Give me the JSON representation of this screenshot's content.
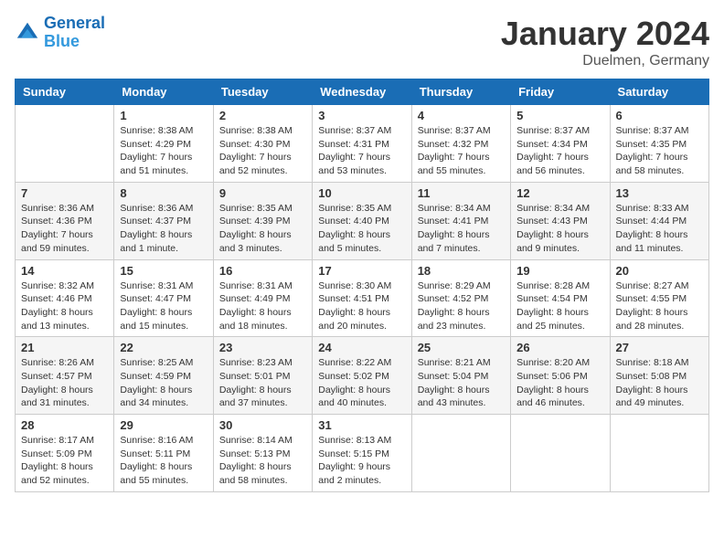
{
  "logo": {
    "line1": "General",
    "line2": "Blue"
  },
  "calendar": {
    "title": "January 2024",
    "subtitle": "Duelmen, Germany"
  },
  "days_of_week": [
    "Sunday",
    "Monday",
    "Tuesday",
    "Wednesday",
    "Thursday",
    "Friday",
    "Saturday"
  ],
  "weeks": [
    [
      {
        "day": "",
        "sunrise": "",
        "sunset": "",
        "daylight": ""
      },
      {
        "day": "1",
        "sunrise": "8:38 AM",
        "sunset": "4:29 PM",
        "daylight": "7 hours and 51 minutes."
      },
      {
        "day": "2",
        "sunrise": "8:38 AM",
        "sunset": "4:30 PM",
        "daylight": "7 hours and 52 minutes."
      },
      {
        "day": "3",
        "sunrise": "8:37 AM",
        "sunset": "4:31 PM",
        "daylight": "7 hours and 53 minutes."
      },
      {
        "day": "4",
        "sunrise": "8:37 AM",
        "sunset": "4:32 PM",
        "daylight": "7 hours and 55 minutes."
      },
      {
        "day": "5",
        "sunrise": "8:37 AM",
        "sunset": "4:34 PM",
        "daylight": "7 hours and 56 minutes."
      },
      {
        "day": "6",
        "sunrise": "8:37 AM",
        "sunset": "4:35 PM",
        "daylight": "7 hours and 58 minutes."
      }
    ],
    [
      {
        "day": "7",
        "sunrise": "8:36 AM",
        "sunset": "4:36 PM",
        "daylight": "7 hours and 59 minutes."
      },
      {
        "day": "8",
        "sunrise": "8:36 AM",
        "sunset": "4:37 PM",
        "daylight": "8 hours and 1 minute."
      },
      {
        "day": "9",
        "sunrise": "8:35 AM",
        "sunset": "4:39 PM",
        "daylight": "8 hours and 3 minutes."
      },
      {
        "day": "10",
        "sunrise": "8:35 AM",
        "sunset": "4:40 PM",
        "daylight": "8 hours and 5 minutes."
      },
      {
        "day": "11",
        "sunrise": "8:34 AM",
        "sunset": "4:41 PM",
        "daylight": "8 hours and 7 minutes."
      },
      {
        "day": "12",
        "sunrise": "8:34 AM",
        "sunset": "4:43 PM",
        "daylight": "8 hours and 9 minutes."
      },
      {
        "day": "13",
        "sunrise": "8:33 AM",
        "sunset": "4:44 PM",
        "daylight": "8 hours and 11 minutes."
      }
    ],
    [
      {
        "day": "14",
        "sunrise": "8:32 AM",
        "sunset": "4:46 PM",
        "daylight": "8 hours and 13 minutes."
      },
      {
        "day": "15",
        "sunrise": "8:31 AM",
        "sunset": "4:47 PM",
        "daylight": "8 hours and 15 minutes."
      },
      {
        "day": "16",
        "sunrise": "8:31 AM",
        "sunset": "4:49 PM",
        "daylight": "8 hours and 18 minutes."
      },
      {
        "day": "17",
        "sunrise": "8:30 AM",
        "sunset": "4:51 PM",
        "daylight": "8 hours and 20 minutes."
      },
      {
        "day": "18",
        "sunrise": "8:29 AM",
        "sunset": "4:52 PM",
        "daylight": "8 hours and 23 minutes."
      },
      {
        "day": "19",
        "sunrise": "8:28 AM",
        "sunset": "4:54 PM",
        "daylight": "8 hours and 25 minutes."
      },
      {
        "day": "20",
        "sunrise": "8:27 AM",
        "sunset": "4:55 PM",
        "daylight": "8 hours and 28 minutes."
      }
    ],
    [
      {
        "day": "21",
        "sunrise": "8:26 AM",
        "sunset": "4:57 PM",
        "daylight": "8 hours and 31 minutes."
      },
      {
        "day": "22",
        "sunrise": "8:25 AM",
        "sunset": "4:59 PM",
        "daylight": "8 hours and 34 minutes."
      },
      {
        "day": "23",
        "sunrise": "8:23 AM",
        "sunset": "5:01 PM",
        "daylight": "8 hours and 37 minutes."
      },
      {
        "day": "24",
        "sunrise": "8:22 AM",
        "sunset": "5:02 PM",
        "daylight": "8 hours and 40 minutes."
      },
      {
        "day": "25",
        "sunrise": "8:21 AM",
        "sunset": "5:04 PM",
        "daylight": "8 hours and 43 minutes."
      },
      {
        "day": "26",
        "sunrise": "8:20 AM",
        "sunset": "5:06 PM",
        "daylight": "8 hours and 46 minutes."
      },
      {
        "day": "27",
        "sunrise": "8:18 AM",
        "sunset": "5:08 PM",
        "daylight": "8 hours and 49 minutes."
      }
    ],
    [
      {
        "day": "28",
        "sunrise": "8:17 AM",
        "sunset": "5:09 PM",
        "daylight": "8 hours and 52 minutes."
      },
      {
        "day": "29",
        "sunrise": "8:16 AM",
        "sunset": "5:11 PM",
        "daylight": "8 hours and 55 minutes."
      },
      {
        "day": "30",
        "sunrise": "8:14 AM",
        "sunset": "5:13 PM",
        "daylight": "8 hours and 58 minutes."
      },
      {
        "day": "31",
        "sunrise": "8:13 AM",
        "sunset": "5:15 PM",
        "daylight": "9 hours and 2 minutes."
      },
      {
        "day": "",
        "sunrise": "",
        "sunset": "",
        "daylight": ""
      },
      {
        "day": "",
        "sunrise": "",
        "sunset": "",
        "daylight": ""
      },
      {
        "day": "",
        "sunrise": "",
        "sunset": "",
        "daylight": ""
      }
    ]
  ],
  "labels": {
    "sunrise_prefix": "Sunrise: ",
    "sunset_prefix": "Sunset: ",
    "daylight_prefix": "Daylight: "
  }
}
